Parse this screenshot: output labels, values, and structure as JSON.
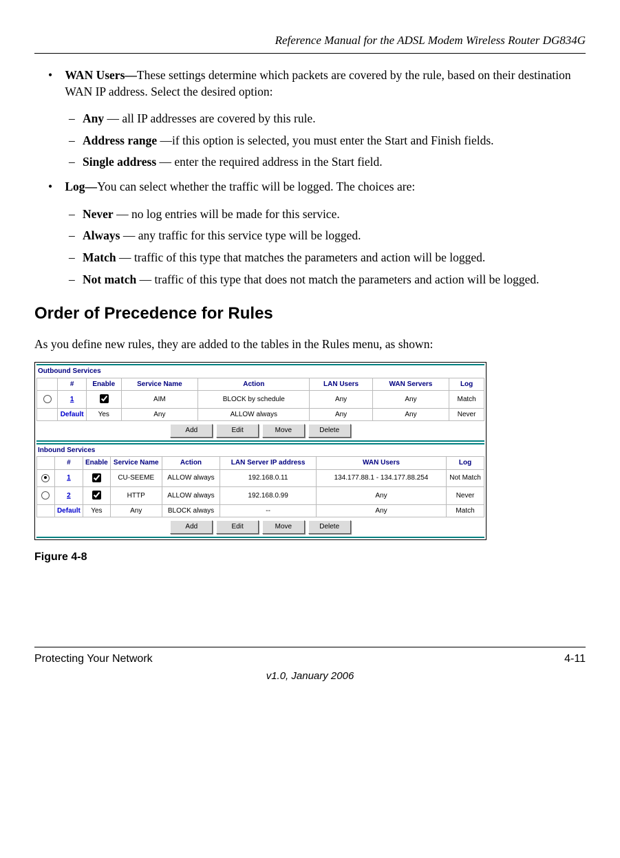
{
  "doc_header": "Reference Manual for the ADSL Modem Wireless Router DG834G",
  "content": {
    "wan_users": {
      "label": "WAN Users—",
      "desc": "These settings determine which packets are covered by the rule, based on their destination WAN IP address. Select the desired option:",
      "items": [
        {
          "term": "Any",
          "text": " — all IP addresses are covered by this rule."
        },
        {
          "term": "Address range",
          "text": " —if this option is selected, you must enter the Start and Finish fields."
        },
        {
          "term": "Single address",
          "text": " — enter the required address in the Start field."
        }
      ]
    },
    "log": {
      "label": "Log—",
      "desc": "You can select whether the traffic will be logged. The choices are:",
      "items": [
        {
          "term": "Never",
          "text": " — no log entries will be made for this service."
        },
        {
          "term": "Always",
          "text": " — any traffic for this service type will be logged."
        },
        {
          "term": "Match",
          "text": " — traffic of this type that matches the parameters and action will be logged."
        },
        {
          "term": "Not match",
          "text": " — traffic of this type that does not match the parameters and action will be logged."
        }
      ]
    },
    "section_heading": "Order of Precedence for Rules",
    "section_para": "As you define new rules, they are added to the tables in the Rules menu, as shown:",
    "figure_caption": "Figure 4-8"
  },
  "screenshot": {
    "outbound": {
      "title": "Outbound Services",
      "headers": [
        "",
        "#",
        "Enable",
        "Service Name",
        "Action",
        "LAN Users",
        "WAN Servers",
        "Log"
      ],
      "rows": [
        {
          "radio": false,
          "num": "1",
          "enable_checked": true,
          "svc": "AIM",
          "action": "BLOCK by schedule",
          "lan": "Any",
          "wan": "Any",
          "log": "Match",
          "num_link": true
        },
        {
          "radio": null,
          "num": "Default",
          "enable_text": "Yes",
          "svc": "Any",
          "action": "ALLOW always",
          "lan": "Any",
          "wan": "Any",
          "log": "Never"
        }
      ]
    },
    "inbound": {
      "title": "Inbound Services",
      "headers": [
        "",
        "#",
        "Enable",
        "Service Name",
        "Action",
        "LAN Server IP address",
        "WAN Users",
        "Log"
      ],
      "rows": [
        {
          "radio": true,
          "num": "1",
          "enable_checked": true,
          "svc": "CU-SEEME",
          "action": "ALLOW always",
          "lan": "192.168.0.11",
          "wan": "134.177.88.1 - 134.177.88.254",
          "log": "Not Match",
          "num_link": true
        },
        {
          "radio": false,
          "num": "2",
          "enable_checked": true,
          "svc": "HTTP",
          "action": "ALLOW always",
          "lan": "192.168.0.99",
          "wan": "Any",
          "log": "Never",
          "num_link": true
        },
        {
          "radio": null,
          "num": "Default",
          "enable_text": "Yes",
          "svc": "Any",
          "action": "BLOCK always",
          "lan": "--",
          "wan": "Any",
          "log": "Match"
        }
      ]
    },
    "buttons": {
      "add": "Add",
      "edit": "Edit",
      "move": "Move",
      "del": "Delete"
    }
  },
  "footer": {
    "left": "Protecting Your Network",
    "right": "4-11",
    "center": "v1.0, January 2006"
  }
}
